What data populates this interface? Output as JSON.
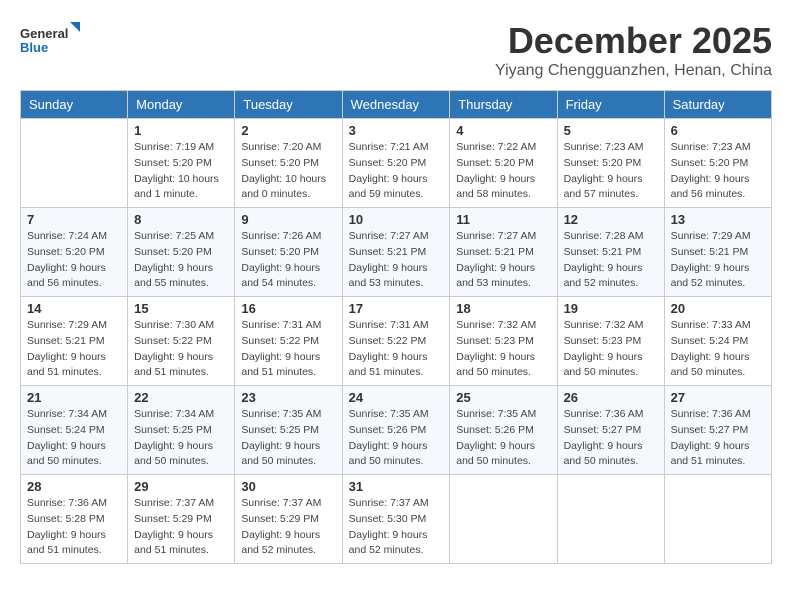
{
  "logo": {
    "general": "General",
    "blue": "Blue"
  },
  "title": "December 2025",
  "location": "Yiyang Chengguanzhen, Henan, China",
  "weekdays": [
    "Sunday",
    "Monday",
    "Tuesday",
    "Wednesday",
    "Thursday",
    "Friday",
    "Saturday"
  ],
  "weeks": [
    [
      {
        "day": "",
        "detail": ""
      },
      {
        "day": "1",
        "detail": "Sunrise: 7:19 AM\nSunset: 5:20 PM\nDaylight: 10 hours\nand 1 minute."
      },
      {
        "day": "2",
        "detail": "Sunrise: 7:20 AM\nSunset: 5:20 PM\nDaylight: 10 hours\nand 0 minutes."
      },
      {
        "day": "3",
        "detail": "Sunrise: 7:21 AM\nSunset: 5:20 PM\nDaylight: 9 hours\nand 59 minutes."
      },
      {
        "day": "4",
        "detail": "Sunrise: 7:22 AM\nSunset: 5:20 PM\nDaylight: 9 hours\nand 58 minutes."
      },
      {
        "day": "5",
        "detail": "Sunrise: 7:23 AM\nSunset: 5:20 PM\nDaylight: 9 hours\nand 57 minutes."
      },
      {
        "day": "6",
        "detail": "Sunrise: 7:23 AM\nSunset: 5:20 PM\nDaylight: 9 hours\nand 56 minutes."
      }
    ],
    [
      {
        "day": "7",
        "detail": "Sunrise: 7:24 AM\nSunset: 5:20 PM\nDaylight: 9 hours\nand 56 minutes."
      },
      {
        "day": "8",
        "detail": "Sunrise: 7:25 AM\nSunset: 5:20 PM\nDaylight: 9 hours\nand 55 minutes."
      },
      {
        "day": "9",
        "detail": "Sunrise: 7:26 AM\nSunset: 5:20 PM\nDaylight: 9 hours\nand 54 minutes."
      },
      {
        "day": "10",
        "detail": "Sunrise: 7:27 AM\nSunset: 5:21 PM\nDaylight: 9 hours\nand 53 minutes."
      },
      {
        "day": "11",
        "detail": "Sunrise: 7:27 AM\nSunset: 5:21 PM\nDaylight: 9 hours\nand 53 minutes."
      },
      {
        "day": "12",
        "detail": "Sunrise: 7:28 AM\nSunset: 5:21 PM\nDaylight: 9 hours\nand 52 minutes."
      },
      {
        "day": "13",
        "detail": "Sunrise: 7:29 AM\nSunset: 5:21 PM\nDaylight: 9 hours\nand 52 minutes."
      }
    ],
    [
      {
        "day": "14",
        "detail": "Sunrise: 7:29 AM\nSunset: 5:21 PM\nDaylight: 9 hours\nand 51 minutes."
      },
      {
        "day": "15",
        "detail": "Sunrise: 7:30 AM\nSunset: 5:22 PM\nDaylight: 9 hours\nand 51 minutes."
      },
      {
        "day": "16",
        "detail": "Sunrise: 7:31 AM\nSunset: 5:22 PM\nDaylight: 9 hours\nand 51 minutes."
      },
      {
        "day": "17",
        "detail": "Sunrise: 7:31 AM\nSunset: 5:22 PM\nDaylight: 9 hours\nand 51 minutes."
      },
      {
        "day": "18",
        "detail": "Sunrise: 7:32 AM\nSunset: 5:23 PM\nDaylight: 9 hours\nand 50 minutes."
      },
      {
        "day": "19",
        "detail": "Sunrise: 7:32 AM\nSunset: 5:23 PM\nDaylight: 9 hours\nand 50 minutes."
      },
      {
        "day": "20",
        "detail": "Sunrise: 7:33 AM\nSunset: 5:24 PM\nDaylight: 9 hours\nand 50 minutes."
      }
    ],
    [
      {
        "day": "21",
        "detail": "Sunrise: 7:34 AM\nSunset: 5:24 PM\nDaylight: 9 hours\nand 50 minutes."
      },
      {
        "day": "22",
        "detail": "Sunrise: 7:34 AM\nSunset: 5:25 PM\nDaylight: 9 hours\nand 50 minutes."
      },
      {
        "day": "23",
        "detail": "Sunrise: 7:35 AM\nSunset: 5:25 PM\nDaylight: 9 hours\nand 50 minutes."
      },
      {
        "day": "24",
        "detail": "Sunrise: 7:35 AM\nSunset: 5:26 PM\nDaylight: 9 hours\nand 50 minutes."
      },
      {
        "day": "25",
        "detail": "Sunrise: 7:35 AM\nSunset: 5:26 PM\nDaylight: 9 hours\nand 50 minutes."
      },
      {
        "day": "26",
        "detail": "Sunrise: 7:36 AM\nSunset: 5:27 PM\nDaylight: 9 hours\nand 50 minutes."
      },
      {
        "day": "27",
        "detail": "Sunrise: 7:36 AM\nSunset: 5:27 PM\nDaylight: 9 hours\nand 51 minutes."
      }
    ],
    [
      {
        "day": "28",
        "detail": "Sunrise: 7:36 AM\nSunset: 5:28 PM\nDaylight: 9 hours\nand 51 minutes."
      },
      {
        "day": "29",
        "detail": "Sunrise: 7:37 AM\nSunset: 5:29 PM\nDaylight: 9 hours\nand 51 minutes."
      },
      {
        "day": "30",
        "detail": "Sunrise: 7:37 AM\nSunset: 5:29 PM\nDaylight: 9 hours\nand 52 minutes."
      },
      {
        "day": "31",
        "detail": "Sunrise: 7:37 AM\nSunset: 5:30 PM\nDaylight: 9 hours\nand 52 minutes."
      },
      {
        "day": "",
        "detail": ""
      },
      {
        "day": "",
        "detail": ""
      },
      {
        "day": "",
        "detail": ""
      }
    ]
  ]
}
